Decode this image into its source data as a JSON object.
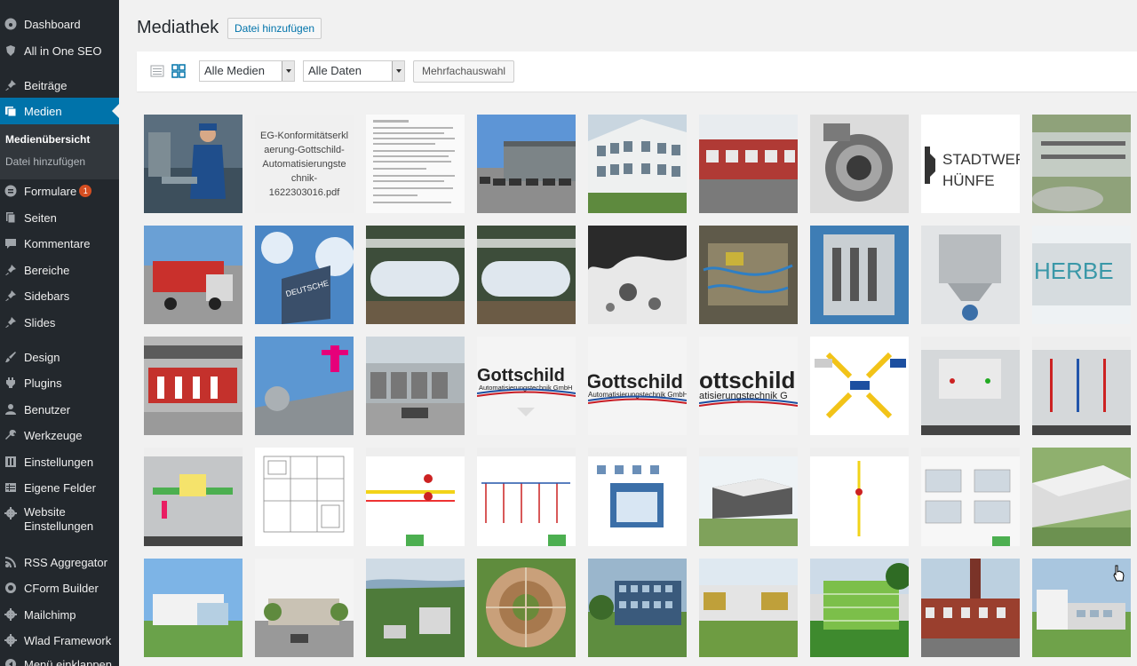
{
  "sidebar": {
    "items": [
      {
        "label": "Dashboard",
        "icon": "dashboard-icon"
      },
      {
        "label": "All in One SEO",
        "icon": "shield-icon"
      },
      {
        "label": "Beiträge",
        "icon": "pin-icon"
      },
      {
        "label": "Medien",
        "icon": "media-icon",
        "active": true
      },
      {
        "label": "Formulare",
        "icon": "form-icon",
        "badge": "1"
      },
      {
        "label": "Seiten",
        "icon": "pages-icon"
      },
      {
        "label": "Kommentare",
        "icon": "comment-icon"
      },
      {
        "label": "Bereiche",
        "icon": "pin-icon"
      },
      {
        "label": "Sidebars",
        "icon": "pin-icon"
      },
      {
        "label": "Slides",
        "icon": "pin-icon"
      },
      {
        "label": "Design",
        "icon": "brush-icon"
      },
      {
        "label": "Plugins",
        "icon": "plugin-icon"
      },
      {
        "label": "Benutzer",
        "icon": "user-icon"
      },
      {
        "label": "Werkzeuge",
        "icon": "wrench-icon"
      },
      {
        "label": "Einstellungen",
        "icon": "settings-icon"
      },
      {
        "label": "Eigene Felder",
        "icon": "table-icon"
      },
      {
        "label": "Website Einstellungen",
        "icon": "gear-icon"
      },
      {
        "label": "RSS Aggregator",
        "icon": "rss-icon"
      },
      {
        "label": "CForm Builder",
        "icon": "cform-icon"
      },
      {
        "label": "Mailchimp",
        "icon": "gear-icon"
      },
      {
        "label": "Wlad Framework",
        "icon": "gear-icon"
      },
      {
        "label": "Menü einklappen",
        "icon": "collapse-icon"
      }
    ],
    "submenu": [
      {
        "label": "Medienübersicht",
        "current": true
      },
      {
        "label": "Datei hinzufügen"
      }
    ]
  },
  "header": {
    "title": "Mediathek",
    "add_button": "Datei hinzufügen"
  },
  "toolbar": {
    "filter_media": "Alle Medien",
    "filter_dates": "Alle Daten",
    "bulk_select": "Mehrfachauswahl"
  },
  "grid": {
    "pdf_name_lines": [
      "EG-Konformitätserkl",
      "aerung-Gottschild-",
      "Automatisierungste",
      "chnik-",
      "1622303016.pdf"
    ],
    "logo_texts": {
      "stadtwerke_line1": "STADTWER",
      "stadtwerke_line2": "HÜNFE",
      "gottschild_a": "Gottschild",
      "gottschild_a_sub": "Automatisierungstechnik GmbH",
      "gottschild_b": "Gottschild",
      "gottschild_b_sub": "Automatisierungstechnik GmbH",
      "gottschild_c": "ottschild",
      "gottschild_c_sub": "atisierungstechnik G",
      "deutsche": "DEUTSCHE",
      "herber": "HERBE"
    }
  },
  "colors": {
    "sidebar_bg": "#23282d",
    "active_bg": "#0073aa",
    "page_bg": "#f1f1f1",
    "badge": "#d54e21",
    "link": "#0073aa"
  }
}
